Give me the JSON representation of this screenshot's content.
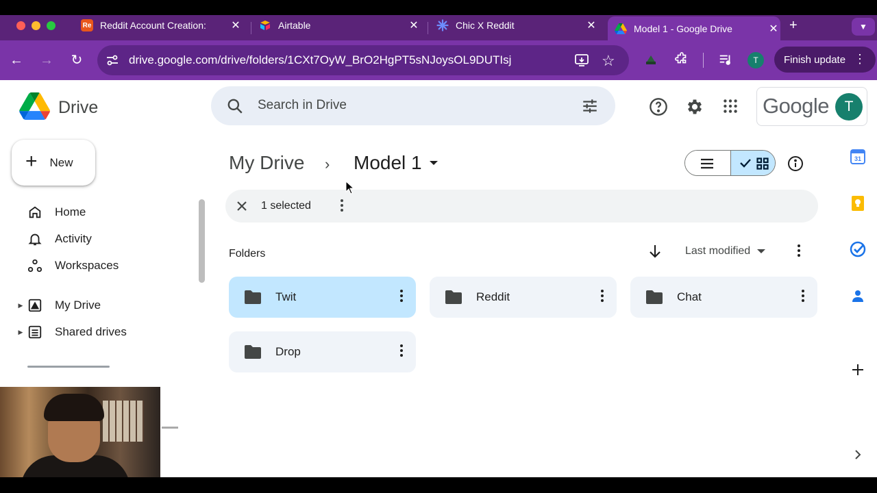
{
  "browser": {
    "tabs": [
      {
        "favicon_text": "Re",
        "title": "Reddit Account Creation:",
        "favicon_color": "#e8571c"
      },
      {
        "favicon_text": "",
        "title": "Airtable",
        "favicon_color": "#fcb400"
      },
      {
        "favicon_text": "",
        "title": "Chic X Reddit",
        "favicon_color": "#4f6df5"
      },
      {
        "favicon_text": "",
        "title": "Model 1 - Google Drive",
        "favicon_color": "#34a853"
      }
    ],
    "url": "drive.google.com/drive/folders/1CXt7OyW_BrO2HgPT5sNJoysOL9DUTIsj",
    "profile_initial": "T",
    "finish_update_label": "Finish update"
  },
  "drive": {
    "app_name": "Drive",
    "search_placeholder": "Search in Drive",
    "google_word": "Google",
    "account_initial": "T",
    "new_label": "New",
    "nav": [
      {
        "label": "Home",
        "icon": "home-icon"
      },
      {
        "label": "Activity",
        "icon": "bell-icon"
      },
      {
        "label": "Workspaces",
        "icon": "workspaces-icon"
      },
      {
        "label": "My Drive",
        "icon": "my-drive-icon"
      },
      {
        "label": "Shared drives",
        "icon": "shared-drives-icon"
      }
    ],
    "breadcrumb": {
      "root": "My Drive",
      "current": "Model 1"
    },
    "selection": {
      "count_label": "1 selected"
    },
    "folders_heading": "Folders",
    "sort_label": "Last modified",
    "folders": [
      {
        "name": "Twit",
        "selected": true
      },
      {
        "name": "Reddit",
        "selected": false
      },
      {
        "name": "Chat",
        "selected": false
      },
      {
        "name": "Drop",
        "selected": false
      }
    ]
  },
  "colors": {
    "chrome_tabstrip": "#5a2378",
    "chrome_toolbar": "#7a34a8",
    "selected_folder": "#c2e7ff",
    "folder_card": "#f0f4f9",
    "avatar": "#17806d"
  }
}
